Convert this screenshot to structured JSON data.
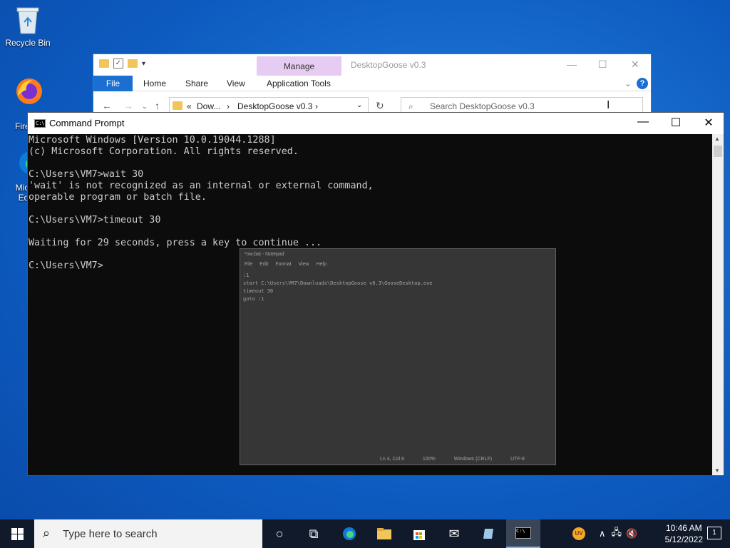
{
  "desktop": {
    "icons": [
      {
        "label": "Recycle Bin",
        "icon": "recycle-bin-icon"
      },
      {
        "label": "Fire",
        "icon": "firefox-icon"
      },
      {
        "label": "Micr Ed",
        "icon": "edge-icon"
      }
    ]
  },
  "explorer": {
    "title": "DesktopGoose v0.3",
    "manage_tab": "Manage",
    "ribbon": {
      "file": "File",
      "home": "Home",
      "share": "Share",
      "view": "View",
      "app_tools": "Application Tools"
    },
    "address": {
      "crumb1": "Dow...",
      "crumb2": "DesktopGoose v0.3"
    },
    "search_placeholder": "Search DesktopGoose v0.3"
  },
  "cmd": {
    "title": "Command Prompt",
    "lines": [
      "Microsoft Windows [Version 10.0.19044.1288]",
      "(c) Microsoft Corporation. All rights reserved.",
      "",
      "C:\\Users\\VM7>wait 30",
      "'wait' is not recognized as an internal or external command,",
      "operable program or batch file.",
      "",
      "C:\\Users\\VM7>timeout 30",
      "",
      "Waiting for 29 seconds, press a key to continue ...",
      "",
      "C:\\Users\\VM7>"
    ]
  },
  "ghost_notepad": {
    "title": "*nw.bat - Notepad",
    "menu": [
      "File",
      "Edit",
      "Format",
      "View",
      "Help"
    ],
    "lines": [
      ":1",
      "start C:\\Users\\VM7\\Downloads\\DesktopGoose v0.3\\GooseDesktop.exe",
      "timeout 30",
      "goto :1"
    ],
    "status": [
      "Ln 4, Col 8",
      "100%",
      "Windows (CRLF)",
      "UTF-8"
    ]
  },
  "taskbar": {
    "search_placeholder": "Type here to search",
    "time": "10:46 AM",
    "date": "5/12/2022",
    "notification_count": "1"
  }
}
